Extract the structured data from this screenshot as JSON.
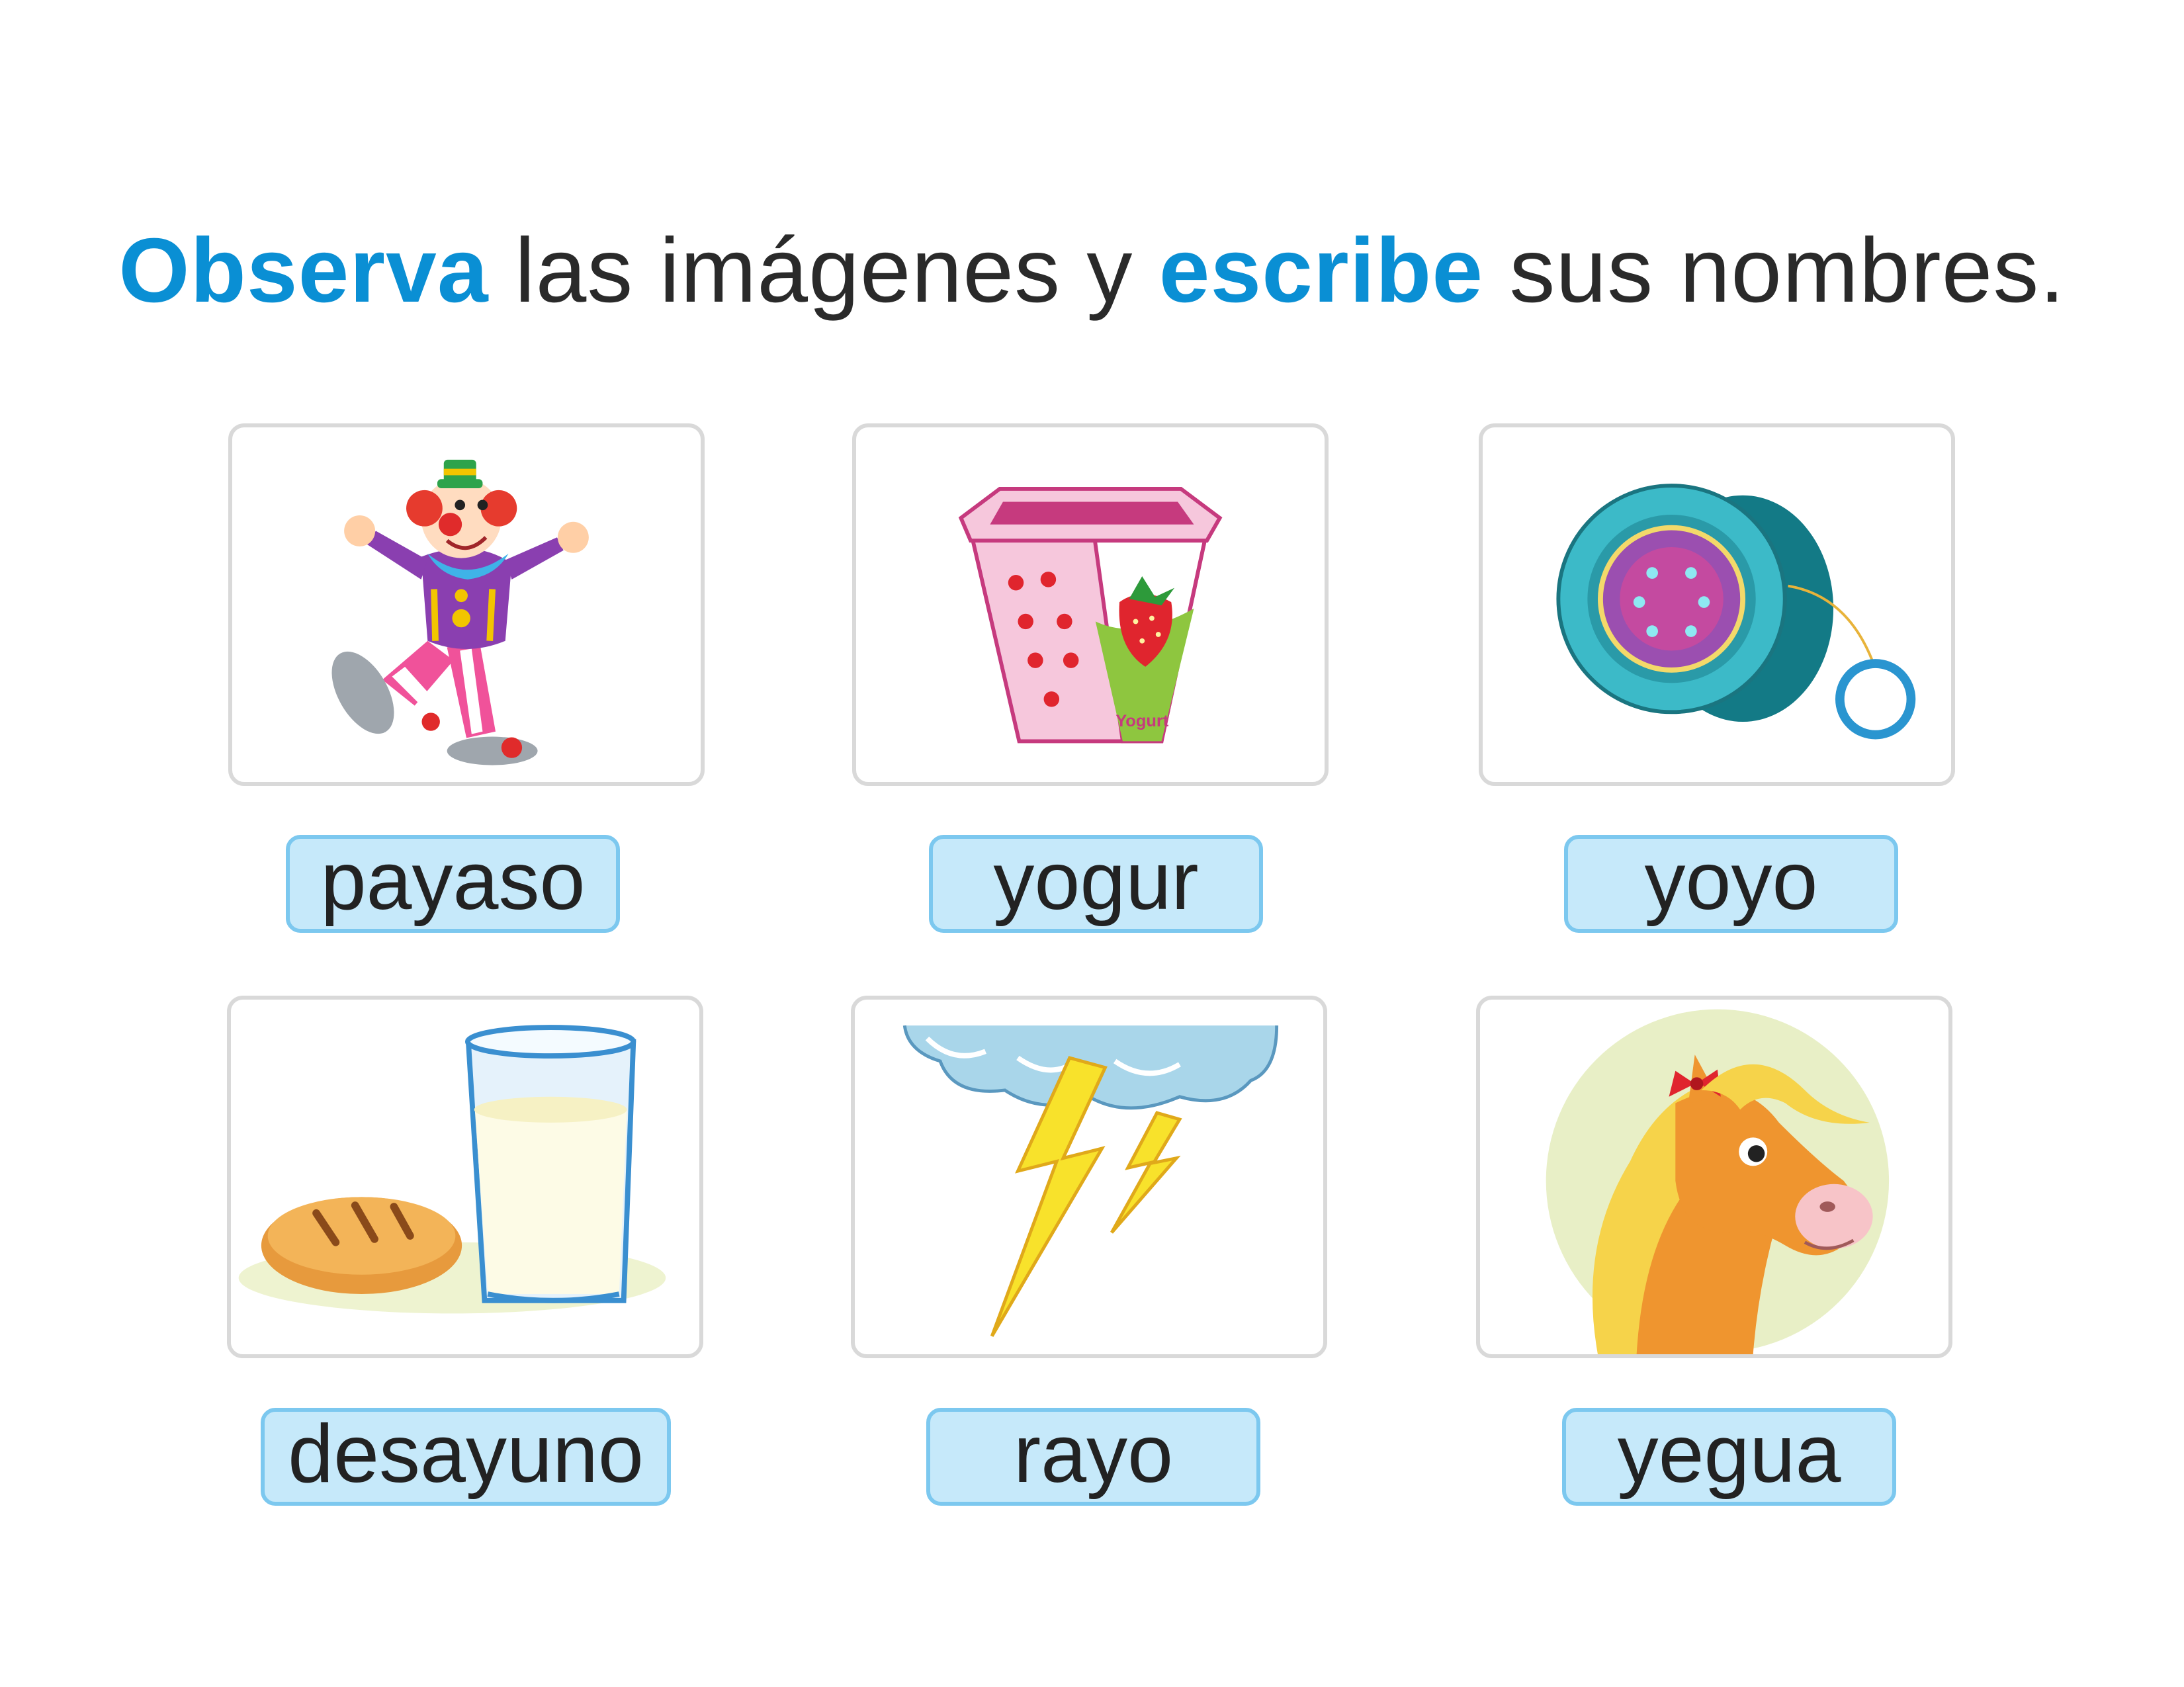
{
  "instruction": {
    "word1": "Observa",
    "part1": " las imágenes y ",
    "word2": "escribe",
    "part2": " sus nombres."
  },
  "items": [
    {
      "label": "payaso",
      "icon": "clown-icon"
    },
    {
      "label": "yogur",
      "icon": "yogurt-icon",
      "package_text": "Yogurt"
    },
    {
      "label": "yoyo",
      "icon": "yoyo-icon"
    },
    {
      "label": "desayuno",
      "icon": "breakfast-icon"
    },
    {
      "label": "rayo",
      "icon": "lightning-icon"
    },
    {
      "label": "yegua",
      "icon": "mare-icon"
    }
  ],
  "colors": {
    "accent": "#0a8fd4",
    "label_fill": "#c6e9fa",
    "label_border": "#7cc8ef",
    "card_border": "#d9d9d9"
  }
}
